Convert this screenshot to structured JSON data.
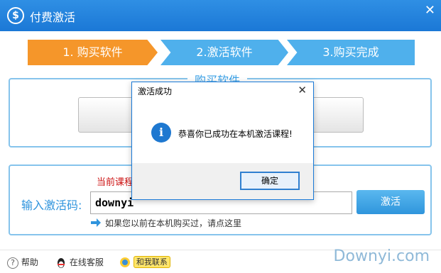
{
  "window": {
    "title": "付费激活",
    "app_icon": "$"
  },
  "steps": [
    {
      "label": "1. 购买软件"
    },
    {
      "label": "2.激活软件"
    },
    {
      "label": "3.购买完成"
    }
  ],
  "buy_panel": {
    "legend": "购买软件"
  },
  "activate_panel": {
    "course_text": "当前课程",
    "code_label": "输入激活码:",
    "code_value": "downyi",
    "activate_label": "激活",
    "bought_link": "如果您以前在本机购买过，请点这里"
  },
  "footer": {
    "help": "帮助",
    "help_icon": "?",
    "service": "在线客服",
    "contact": "和我联系",
    "watermark": "Downyi.com"
  },
  "dialog": {
    "title": "激活成功",
    "close": "✕",
    "info_icon": "i",
    "message": "恭喜你已成功在本机激活课程!",
    "ok_label": "确定"
  },
  "colors": {
    "title_bar": "#1b78d6",
    "active_step": "#f5962a",
    "inactive_step": "#4fb0ec",
    "panel_border": "#86c4ec",
    "course_text": "#cc1111"
  }
}
